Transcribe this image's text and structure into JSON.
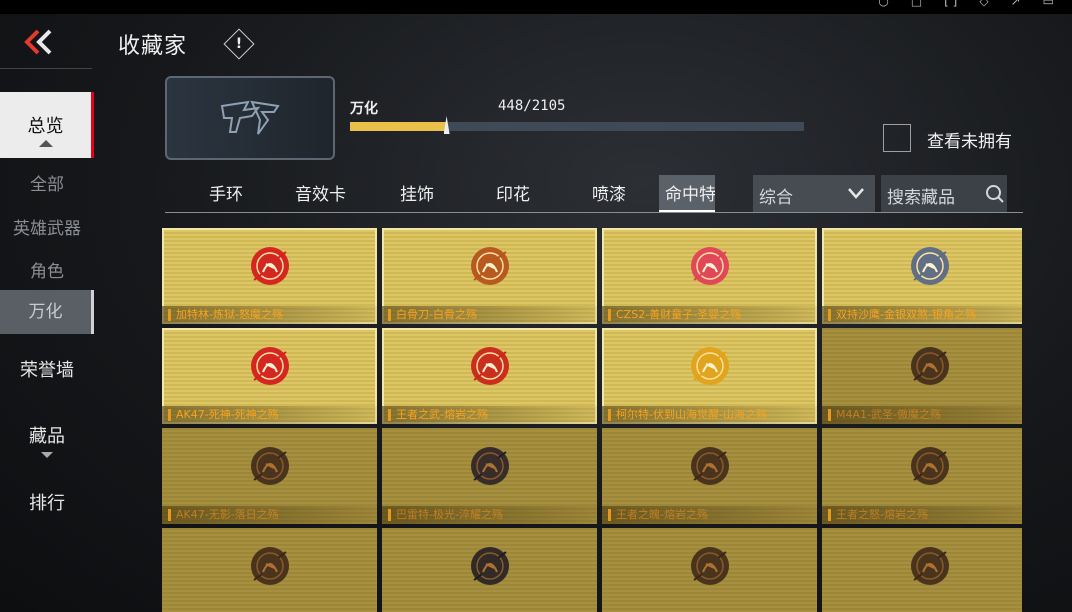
{
  "header": {
    "title": "收藏家",
    "info_mark": "!"
  },
  "sidebar": {
    "main_overview": "总览",
    "subs": [
      "全部",
      "英雄武器",
      "角色",
      "万化"
    ],
    "main_items": [
      "荣誉墙",
      "藏品",
      "排行"
    ]
  },
  "progress": {
    "name": "万化",
    "owned": 448,
    "total": 2105,
    "count_text": "448/2105",
    "fill_fraction": 0.2128,
    "show_unowned_label": "查看未拥有"
  },
  "tabs": [
    "手环",
    "音效卡",
    "挂饰",
    "印花",
    "喷漆",
    "命中特"
  ],
  "filter": {
    "dropdown_value": "综合",
    "search_placeholder": "搜索藏品"
  },
  "colors": {
    "gold": "#dcc665",
    "accent_orange": "#f7a321",
    "active_red": "#e5001c"
  },
  "cards": [
    {
      "name": "加特林-炼狱-怒魔之殇",
      "owned": true,
      "icon": "red-demon-emblem",
      "color": "#d41f1f"
    },
    {
      "name": "白骨刀-白骨之殇",
      "owned": true,
      "icon": "bone-blade-emblem",
      "color": "#b5541c"
    },
    {
      "name": "CZS2-善财童子-圣婴之殇",
      "owned": true,
      "icon": "crown-emblem",
      "color": "#e0415a"
    },
    {
      "name": "双持沙鹰-金银双煞-银角之殇",
      "owned": true,
      "icon": "silver-horn-emblem",
      "color": "#5a6a88"
    },
    {
      "name": "AK47-死神-死神之殇",
      "owned": true,
      "icon": "reaper-emblem",
      "color": "#d41f1f"
    },
    {
      "name": "王者之武-熔岩之殇",
      "owned": true,
      "icon": "lava-emblem",
      "color": "#c9261a"
    },
    {
      "name": "柯尔特-伏到山海觉醒-山海之殇",
      "owned": true,
      "icon": "mountain-sea-emblem",
      "color": "#e0a21a"
    },
    {
      "name": "M4A1-武圣-傲魔之殇",
      "owned": false,
      "icon": "martial-saint-emblem",
      "color": "#3a2518"
    },
    {
      "name": "AK47-无影-落日之殇",
      "owned": false,
      "icon": "sunset-emblem",
      "color": "#3a2518"
    },
    {
      "name": "巴雷特-极光-淬耀之殇",
      "owned": false,
      "icon": "aurora-emblem",
      "color": "#241c28"
    },
    {
      "name": "王者之魄-熔岩之殇",
      "owned": false,
      "icon": "soul-lava-emblem",
      "color": "#3a2518"
    },
    {
      "name": "王者之怒-熔岩之殇",
      "owned": false,
      "icon": "rage-lava-emblem",
      "color": "#3a2518"
    },
    {
      "name": "",
      "owned": false,
      "icon": "locked-emblem",
      "color": "#3a2518"
    },
    {
      "name": "",
      "owned": false,
      "icon": "locked-emblem",
      "color": "#1d1a24"
    },
    {
      "name": "",
      "owned": false,
      "icon": "locked-emblem",
      "color": "#3a2518"
    },
    {
      "name": "",
      "owned": false,
      "icon": "locked-emblem",
      "color": "#3a2518"
    }
  ]
}
